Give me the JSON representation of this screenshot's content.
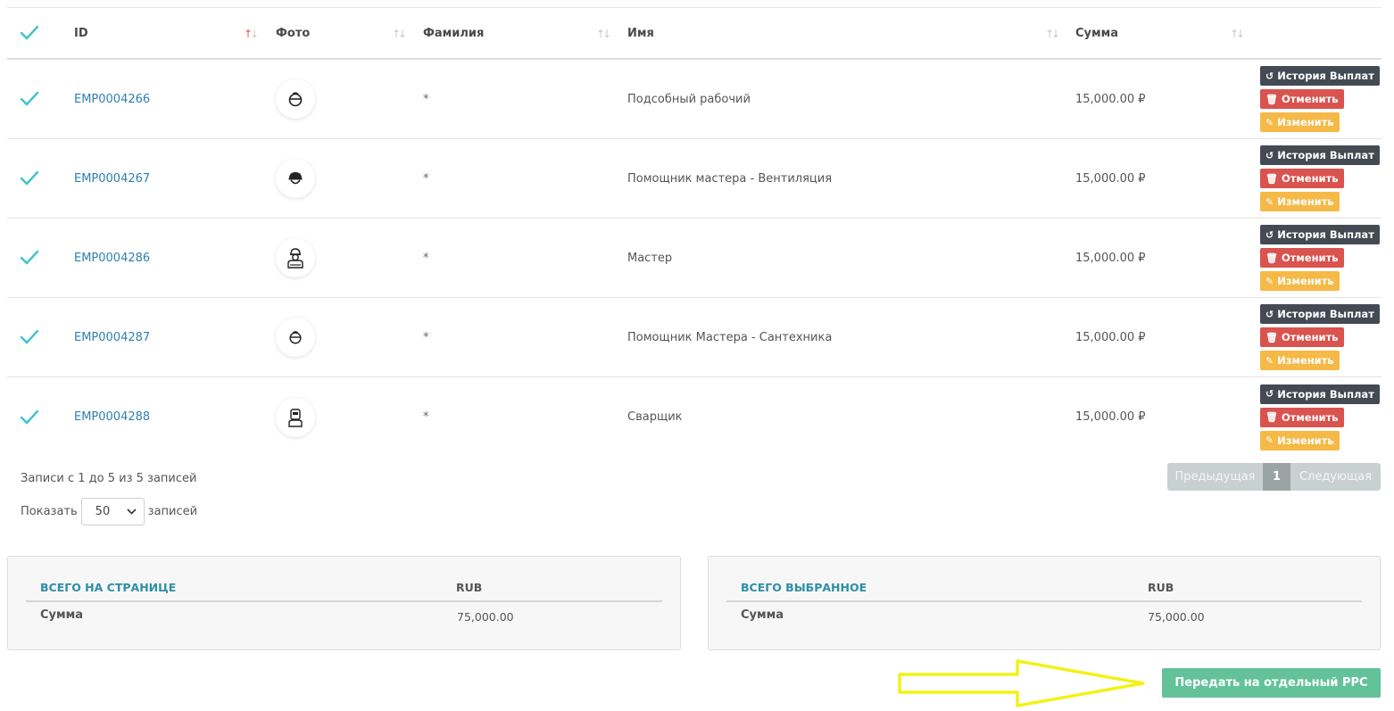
{
  "table": {
    "headers": {
      "id": "ID",
      "photo": "Фото",
      "surname": "Фамилия",
      "name": "Имя",
      "sum": "Сумма"
    },
    "rows": [
      {
        "id": "EMP0004266",
        "surname": "*",
        "name": "Подсобный рабочий",
        "sum": "15,000.00 ₽",
        "avatar_icon": "worker-helmet-icon"
      },
      {
        "id": "EMP0004267",
        "surname": "*",
        "name": "Помощник мастера - Вентиляция",
        "sum": "15,000.00 ₽",
        "avatar_icon": "worker-hardhat-icon"
      },
      {
        "id": "EMP0004286",
        "surname": "*",
        "name": "Мастер",
        "sum": "15,000.00 ₽",
        "avatar_icon": "foreman-icon"
      },
      {
        "id": "EMP0004287",
        "surname": "*",
        "name": "Помощник Мастера - Сантехника",
        "sum": "15,000.00 ₽",
        "avatar_icon": "worker-helmet-icon"
      },
      {
        "id": "EMP0004288",
        "surname": "*",
        "name": "Сварщик",
        "sum": "15,000.00 ₽",
        "avatar_icon": "welder-icon"
      }
    ],
    "actions": {
      "history": "История Выплат",
      "cancel": "Отменить",
      "edit": "Изменить"
    }
  },
  "footer": {
    "info": "Записи с 1 до 5 из 5 записей",
    "show_prefix": "Показать",
    "show_value": "50",
    "show_suffix": "записей",
    "pager": {
      "prev": "Предыдущая",
      "current": "1",
      "next": "Следующая"
    }
  },
  "totals": {
    "page": {
      "title": "ВСЕГО НА СТРАНИЦЕ",
      "currency": "RUB",
      "label": "Сумма",
      "value": "75,000.00"
    },
    "selected": {
      "title": "ВСЕГО ВЫБРАННОЕ",
      "currency": "RUB",
      "label": "Сумма",
      "value": "75,000.00"
    }
  },
  "transfer_button": "Передать на отдельный РРС",
  "colors": {
    "check": "#3fc3cf",
    "link": "#2f7fb0",
    "history_btn": "#434a54",
    "cancel_btn": "#d9534f",
    "edit_btn": "#f5b947",
    "transfer_btn": "#63c29a",
    "annotation_arrow": "#f2f216"
  }
}
